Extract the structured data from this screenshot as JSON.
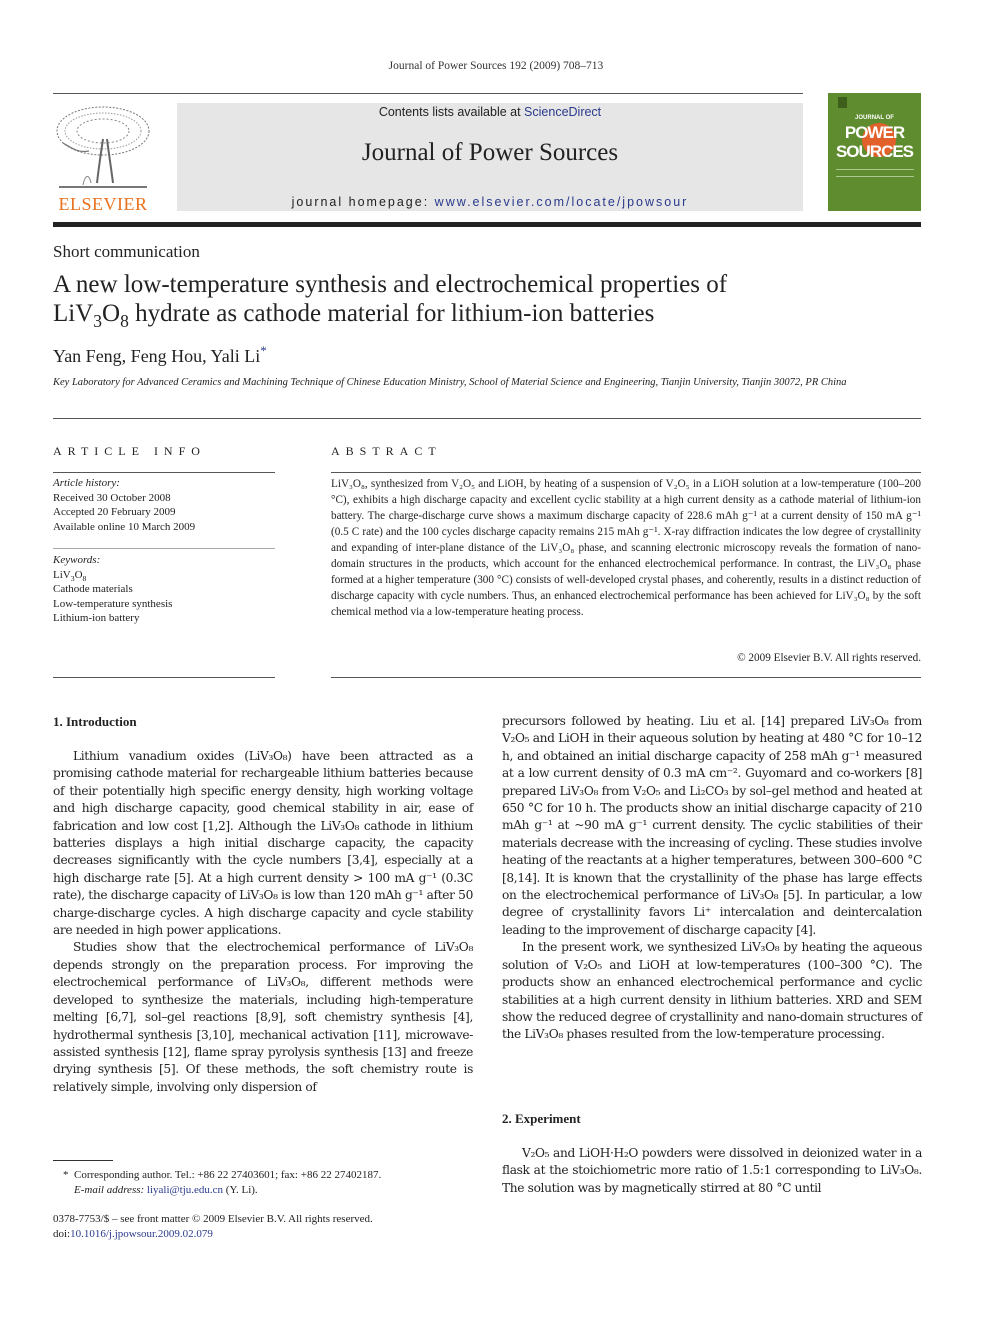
{
  "running_head": "Journal of Power Sources 192 (2009) 708–713",
  "banner": {
    "contents_prefix": "Contents lists available at ",
    "contents_link": "ScienceDirect",
    "journal_title": "Journal of Power Sources",
    "homepage_prefix": "journal homepage: ",
    "homepage_link": "www.elsevier.com/locate/jpowsour"
  },
  "publisher_logo": {
    "word": "ELSEVIER",
    "color": "#e9711c"
  },
  "cover": {
    "line1": "JOURNAL OF",
    "line2": "POWER",
    "line3": "SOURCES",
    "color": "#5f8c2e",
    "accent": "#e2612a"
  },
  "article": {
    "type": "Short communication",
    "title_part1": "A new low-temperature synthesis and electrochemical properties of",
    "title_part2_pre": "LiV",
    "title_sub1": "3",
    "title_mid": "O",
    "title_sub2": "8",
    "title_part2_post": " hydrate as cathode material for lithium-ion batteries",
    "authors": "Yan Feng, Feng Hou, Yali Li",
    "corresponding_mark": "*",
    "affiliation": "Key Laboratory for Advanced Ceramics and Machining Technique of Chinese Education Ministry, School of Material Science and Engineering, Tianjin University, Tianjin 30072, PR China"
  },
  "article_info": {
    "heading": "ARTICLE INFO",
    "history_label": "Article history:",
    "history": [
      "Received 30 October 2008",
      "Accepted 20 February 2009",
      "Available online 10 March 2009"
    ],
    "keywords_label": "Keywords:",
    "keywords": [
      "LiV3O8",
      "Cathode materials",
      "Low-temperature synthesis",
      "Lithium-ion battery"
    ]
  },
  "abstract": {
    "heading": "ABSTRACT",
    "text": "LiV₃O₈, synthesized from V₂O₅ and LiOH, by heating of a suspension of V₂O₅ in a LiOH solution at a low-temperature (100–200 °C), exhibits a high discharge capacity and excellent cyclic stability at a high current density as a cathode material of lithium-ion battery. The charge-discharge curve shows a maximum discharge capacity of 228.6 mAh g⁻¹ at a current density of 150 mA g⁻¹ (0.5 C rate) and the 100 cycles discharge capacity remains 215 mAh g⁻¹. X-ray diffraction indicates the low degree of crystallinity and expanding of inter-plane distance of the LiV₃O₈ phase, and scanning electronic microscopy reveals the formation of nano-domain structures in the products, which account for the enhanced electrochemical performance. In contrast, the LiV₃O₈ phase formed at a higher temperature (300 °C) consists of well-developed crystal phases, and coherently, results in a distinct reduction of discharge capacity with cycle numbers. Thus, an enhanced electrochemical performance has been achieved for LiV₃O₈ by the soft chemical method via a low-temperature heating process.",
    "copyright": "© 2009 Elsevier B.V. All rights reserved."
  },
  "sections": {
    "intro_heading": "1.  Introduction",
    "intro_p1": "Lithium vanadium oxides (LiV₃O₈) have been attracted as a promising cathode material for rechargeable lithium batteries because of their potentially high specific energy density, high working voltage and high discharge capacity, good chemical stability in air, ease of fabrication and low cost [1,2]. Although the LiV₃O₈ cathode in lithium batteries displays a high initial discharge capacity, the capacity decreases significantly with the cycle numbers [3,4], especially at a high discharge rate [5]. At a high current density > 100 mA g⁻¹ (0.3C rate), the discharge capacity of LiV₃O₈ is low than 120 mAh g⁻¹ after 50 charge-discharge cycles. A high discharge capacity and cycle stability are needed in high power applications.",
    "intro_p2": "Studies show that the electrochemical performance of LiV₃O₈ depends strongly on the preparation process. For improving the electrochemical performance of LiV₃O₈, different methods were developed to synthesize the materials, including high-temperature melting [6,7], sol–gel reactions [8,9], soft chemistry synthesis [4], hydrothermal synthesis [3,10], mechanical activation [11], microwave-assisted synthesis [12], flame spray pyrolysis synthesis [13] and freeze drying synthesis [5]. Of these methods, the soft chemistry route is relatively simple, involving only dispersion of",
    "right_p1": "precursors followed by heating. Liu et al. [14] prepared LiV₃O₈ from V₂O₅ and LiOH in their aqueous solution by heating at 480 °C for 10–12 h, and obtained an initial discharge capacity of 258 mAh g⁻¹ measured at a low current density of 0.3 mA cm⁻². Guyomard and co-workers [8] prepared LiV₃O₈ from V₂O₅ and Li₂CO₃ by sol–gel method and heated at 650 °C for 10 h. The products show an initial discharge capacity of 210 mAh g⁻¹ at ~90 mA g⁻¹ current density. The cyclic stabilities of their materials decrease with the increasing of cycling. These studies involve heating of the reactants at a higher temperatures, between 300–600 °C [8,14]. It is known that the crystallinity of the phase has large effects on the electrochemical performance of LiV₃O₈ [5]. In particular, a low degree of crystallinity favors Li⁺ intercalation and deintercalation leading to the improvement of discharge capacity [4].",
    "right_p2": "In the present work, we synthesized LiV₃O₈ by heating the aqueous solution of V₂O₅ and LiOH at low-temperatures (100–300 °C). The products show an enhanced electrochemical performance and cyclic stabilities at a high current density in lithium batteries. XRD and SEM show the reduced degree of crystallinity and nano-domain structures of the LiV₃O₈ phases resulted from the low-temperature processing.",
    "exp_heading": "2.  Experiment",
    "exp_p1": "V₂O₅ and LiOH·H₂O powders were dissolved in deionized water in a flask at the stoichiometric more ratio of 1.5:1 corresponding to LiV₃O₈. The solution was by magnetically stirred at 80 °C until"
  },
  "footnote": {
    "mark": "*",
    "text": "Corresponding author. Tel.: +86 22 27403601; fax: +86 22 27402187.",
    "email_label": "E-mail address:",
    "email": "liyali@tju.edu.cn",
    "email_suffix": " (Y. Li)."
  },
  "front_matter": {
    "issn": "0378-7753/$ – see front matter © 2009 Elsevier B.V. All rights reserved.",
    "doi_prefix": "doi:",
    "doi": "10.1016/j.jpowsour.2009.02.079"
  },
  "colors": {
    "link": "#2a3a8c",
    "banner_bg": "#e6e6e6"
  }
}
